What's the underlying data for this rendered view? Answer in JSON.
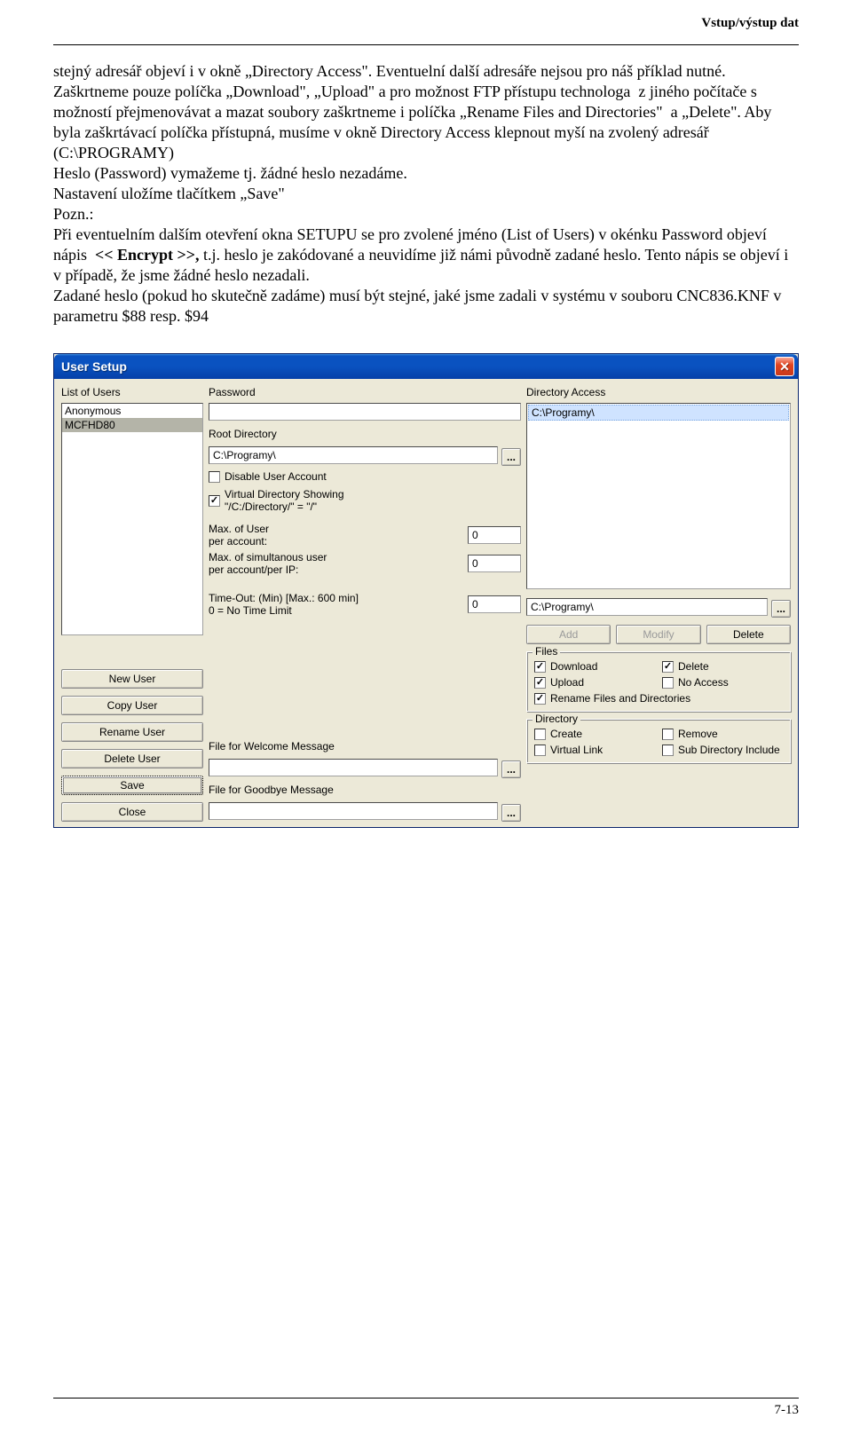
{
  "header": {
    "right": "Vstup/výstup dat"
  },
  "body": {
    "p1": "stejný adresář objeví i v okně „Directory Access\". Eventuelní další adresáře nejsou pro náš příklad nutné. Zaškrtneme pouze políčka „Download\", „Upload\" a pro možnost FTP přístupu technologa  z jiného počítače s možností přejmenovávat a mazat soubory zaškrtneme i políčka „Rename Files and Directories\"  a „Delete\". Aby byla zaškrtávací políčka přístupná, musíme v okně Directory Access klepnout myší na zvolený adresář (C:\\PROGRAMY)",
    "p2": "Heslo (Password) vymažeme tj. žádné heslo nezadáme.",
    "p3": "Nastavení uložíme tlačítkem „Save\"",
    "p4": "Pozn.:",
    "p5a": "Při eventuelním dalším otevření okna SETUPU se pro zvolené jméno (List of Users) v okénku Password objeví nápis  ",
    "p5b": "<< Encrypt >>,",
    "p5c": " t.j. heslo je zakódované a neuvidíme již námi původně zadané heslo. Tento nápis se objeví i v případě, že jsme žádné heslo nezadali.",
    "p6": "Zadané heslo (pokud ho skutečně zadáme) musí být stejné, jaké jsme zadali v systému v souboru CNC836.KNF v parametru $88 resp. $94"
  },
  "win": {
    "title": "User Setup",
    "left": {
      "list_label": "List of Users",
      "users": [
        "Anonymous",
        "MCFHD80"
      ],
      "selected_index": 1,
      "buttons": [
        "New User",
        "Copy User",
        "Rename User",
        "Delete User",
        "Save",
        "Close"
      ]
    },
    "mid": {
      "password_label": "Password",
      "password_value": "",
      "rootdir_label": "Root Directory",
      "rootdir_value": "C:\\Programy\\",
      "browse": "...",
      "chk_disable": "Disable User Account",
      "chk_vds1": "Virtual Directory Showing",
      "chk_vds2": "\"/C:/Directory/\" = \"/\"",
      "max_user_l1": "Max. of User",
      "max_user_l2": "per account:",
      "max_user_val": "0",
      "max_sim_l1": "Max. of simultanous user",
      "max_sim_l2": "per account/per IP:",
      "max_sim_val": "0",
      "timeout_l1": "Time-Out: (Min) [Max.: 600 min]",
      "timeout_l2": "0 = No Time Limit",
      "timeout_val": "0",
      "welcome_label": "File for Welcome Message",
      "goodbye_label": "File for Goodbye Message"
    },
    "right": {
      "dir_access_label": "Directory Access",
      "dir_item": "C:\\Programy\\",
      "path_value": "C:\\Programy\\",
      "btn_add": "Add",
      "btn_modify": "Modify",
      "btn_delete": "Delete",
      "files_legend": "Files",
      "files_download": "Download",
      "files_delete": "Delete",
      "files_upload": "Upload",
      "files_noaccess": "No Access",
      "files_rename": "Rename Files and Directories",
      "dir_legend": "Directory",
      "dir_create": "Create",
      "dir_remove": "Remove",
      "dir_vlink": "Virtual Link",
      "dir_subinc": "Sub Directory Include"
    }
  },
  "footer": {
    "page": "7-13"
  }
}
